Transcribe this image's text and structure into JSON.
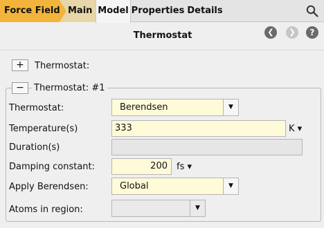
{
  "tabs": {
    "force_field": "Force Field",
    "main": "Main",
    "model": "Model",
    "properties": "Properties",
    "details": "Details"
  },
  "header": {
    "title": "Thermostat"
  },
  "collapsed_section": {
    "toggle": "+",
    "label": "Thermostat:"
  },
  "expanded_section": {
    "toggle": "−",
    "label": "Thermostat: #1",
    "thermostat": {
      "label": "Thermostat:",
      "value": "Berendsen"
    },
    "temperature": {
      "label": "Temperature(s)",
      "value": "333",
      "unit": "K ▾"
    },
    "duration": {
      "label": "Duration(s)",
      "value": ""
    },
    "damping": {
      "label": "Damping constant:",
      "value": "200",
      "unit": "fs ▾"
    },
    "apply": {
      "label": "Apply Berendsen:",
      "value": "Global"
    },
    "atoms_region": {
      "label": "Atoms in region:",
      "value": ""
    }
  },
  "colors": {
    "force_field_tab": "#f2b43a",
    "main_tab": "#e7d7a8",
    "field_bg": "#fffbd9"
  },
  "icons": [
    "search-icon",
    "back-icon",
    "forward-icon",
    "help-icon",
    "dropdown-arrow-icon"
  ]
}
